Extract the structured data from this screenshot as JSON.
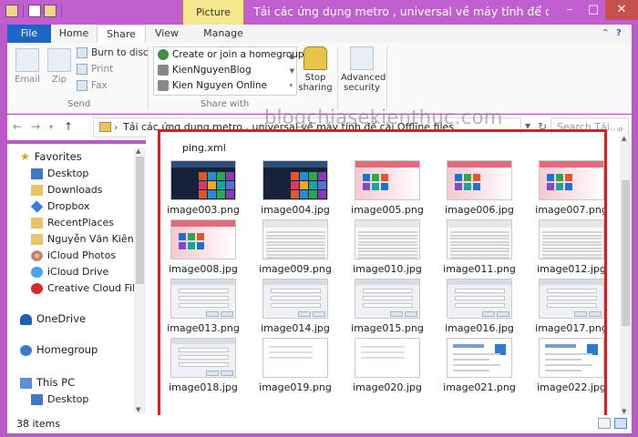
{
  "window": {
    "title": "Tải các ứng dụng metro , universal về máy tính để cài Offline files",
    "contextual_tab": "Picture Tools",
    "controls": {
      "minimize": "–",
      "maximize": "□",
      "close": "✕"
    }
  },
  "ribbon": {
    "tabs": {
      "file": "File",
      "home": "Home",
      "share": "Share",
      "view": "View",
      "manage": "Manage"
    },
    "send": {
      "group_label": "Send",
      "email": "Email",
      "zip": "Zip",
      "burn": "Burn to disc",
      "print": "Print",
      "fax": "Fax"
    },
    "share_with": {
      "group_label": "Share with",
      "items": [
        "Create or join a homegroup",
        "KienNguyenBlog",
        "Kien Nguyen Online"
      ]
    },
    "stop_sharing": "Stop sharing",
    "advanced_security": "Advanced security",
    "minimize_ribbon_icon": "chevron-up-icon",
    "help_icon": "help-icon"
  },
  "address": {
    "path": "Tải các ứng dụng metro , universal về máy tính để cài Offline files",
    "search_placeholder": "Search Tải...",
    "watermark": "blogchiasekienthuc.com"
  },
  "navigation": {
    "items": [
      {
        "label": "Favorites",
        "icon": "star-icon",
        "level": 0
      },
      {
        "label": "Desktop",
        "icon": "desktop-icon",
        "level": 1
      },
      {
        "label": "Downloads",
        "icon": "downloads-icon",
        "level": 1
      },
      {
        "label": "Dropbox",
        "icon": "dropbox-icon",
        "level": 1
      },
      {
        "label": "RecentPlaces",
        "icon": "recent-places-icon",
        "level": 1
      },
      {
        "label": "Nguyễn Văn Kiên",
        "icon": "user-folder-icon",
        "level": 1
      },
      {
        "label": "iCloud Photos",
        "icon": "icloud-photos-icon",
        "level": 1
      },
      {
        "label": "iCloud Drive",
        "icon": "icloud-drive-icon",
        "level": 1
      },
      {
        "label": "Creative Cloud Files",
        "icon": "creative-cloud-icon",
        "level": 1
      },
      {
        "label": "OneDrive",
        "icon": "onedrive-icon",
        "level": 0
      },
      {
        "label": "Homegroup",
        "icon": "homegroup-icon",
        "level": 0
      },
      {
        "label": "This PC",
        "icon": "computer-icon",
        "level": 0
      },
      {
        "label": "Desktop",
        "icon": "desktop-icon",
        "level": 1
      }
    ]
  },
  "files": {
    "top_file": "ping.xml",
    "items": [
      {
        "name": "image003.png",
        "thumb": "metro"
      },
      {
        "name": "image004.jpg",
        "thumb": "metro"
      },
      {
        "name": "image005.png",
        "thumb": "pink"
      },
      {
        "name": "image006.jpg",
        "thumb": "pink"
      },
      {
        "name": "image007.png",
        "thumb": "pink"
      },
      {
        "name": "image008.jpg",
        "thumb": "pink"
      },
      {
        "name": "image009.png",
        "thumb": "sheet"
      },
      {
        "name": "image010.jpg",
        "thumb": "sheet"
      },
      {
        "name": "image011.png",
        "thumb": "sheet"
      },
      {
        "name": "image012.jpg",
        "thumb": "sheet"
      },
      {
        "name": "image013.png",
        "thumb": "dialog"
      },
      {
        "name": "image014.jpg",
        "thumb": "dialog"
      },
      {
        "name": "image015.png",
        "thumb": "dialog"
      },
      {
        "name": "image016.jpg",
        "thumb": "dialog"
      },
      {
        "name": "image017.png",
        "thumb": "dialog"
      },
      {
        "name": "image018.jpg",
        "thumb": "dialog"
      },
      {
        "name": "image019.png",
        "thumb": "blank"
      },
      {
        "name": "image020.jpg",
        "thumb": "blank"
      },
      {
        "name": "image021.png",
        "thumb": "deploy"
      },
      {
        "name": "image022.jpg",
        "thumb": "deploy"
      }
    ]
  },
  "status": {
    "item_count": "38 items"
  },
  "colors": {
    "title_bar": "#c25fd0",
    "file_tab": "#1a67c8",
    "contextual_tab": "#f3e88c",
    "highlight_frame": "#e01c1c",
    "close_button": "#c7504b"
  }
}
